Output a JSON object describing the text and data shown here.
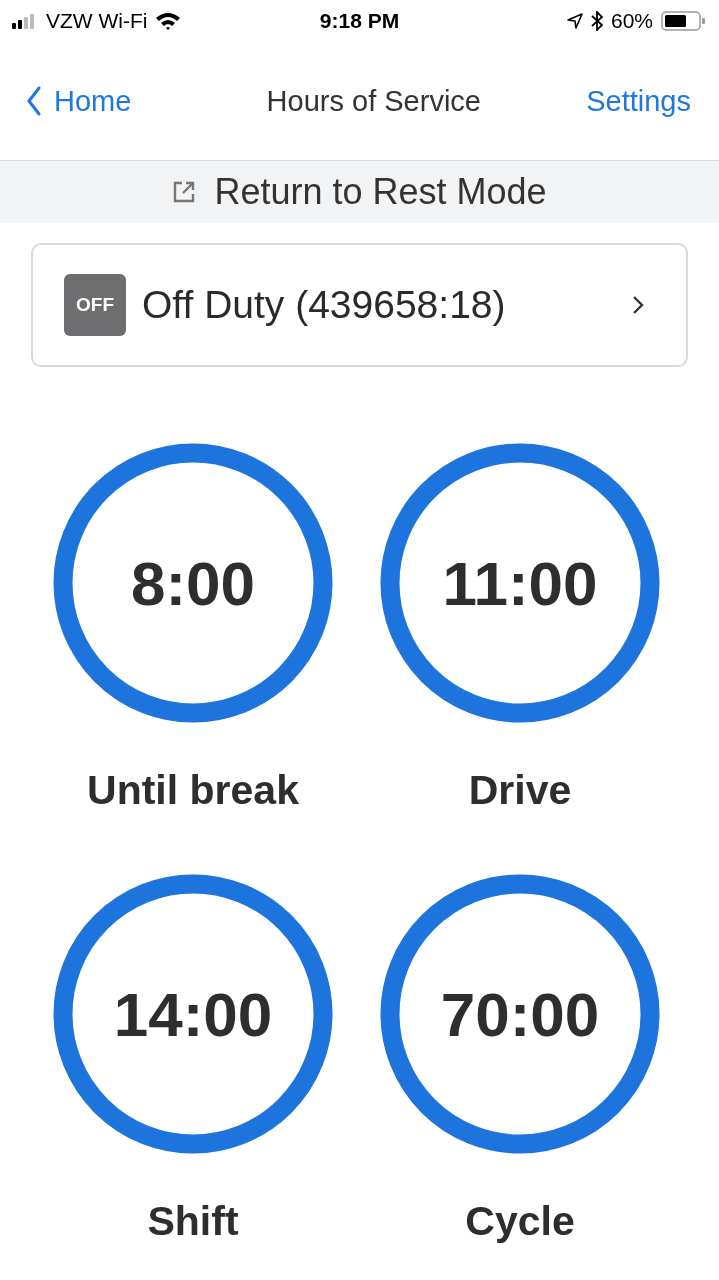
{
  "status_bar": {
    "carrier": "VZW Wi-Fi",
    "time": "9:18 PM",
    "battery": "60%"
  },
  "nav": {
    "back": "Home",
    "title": "Hours of Service",
    "action": "Settings"
  },
  "banner": {
    "label": "Return to Rest Mode"
  },
  "duty_status": {
    "badge": "OFF",
    "label": "Off Duty (439658:18)"
  },
  "timers": [
    {
      "value": "8:00",
      "label": "Until break",
      "level": 1
    },
    {
      "value": "11:00",
      "label": "Drive",
      "level": 1
    },
    {
      "value": "14:00",
      "label": "Shift",
      "level": 1
    },
    {
      "value": "70:00",
      "label": "Cycle",
      "level": 1
    }
  ]
}
